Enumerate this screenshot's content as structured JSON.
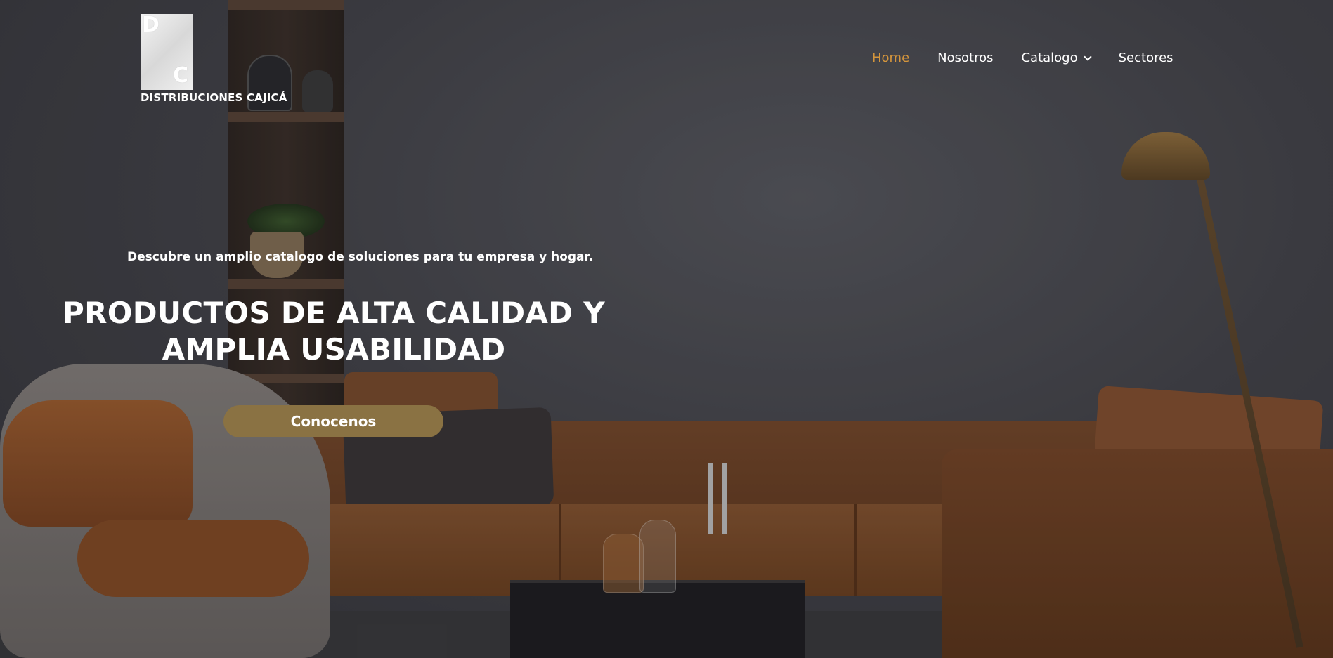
{
  "brand": {
    "name": "DISTRIBUCIONES CAJICÁ",
    "logo_letters": [
      "D",
      "C"
    ]
  },
  "nav": {
    "items": [
      {
        "label": "Home",
        "active": true
      },
      {
        "label": "Nosotros",
        "active": false
      },
      {
        "label": "Catalogo",
        "active": false,
        "has_dropdown": true
      },
      {
        "label": "Sectores",
        "active": false
      }
    ]
  },
  "hero": {
    "subtitle": "Descubre un amplio catalogo de soluciones para tu empresa y hogar.",
    "headline": "PRODUCTOS DE ALTA CALIDAD Y AMPLIA USABILIDAD",
    "cta_label": "Conocenos",
    "background": "living-room-photo"
  },
  "colors": {
    "accent": "#d4953c",
    "cta_background": "#8a7243",
    "text": "#ffffff"
  }
}
